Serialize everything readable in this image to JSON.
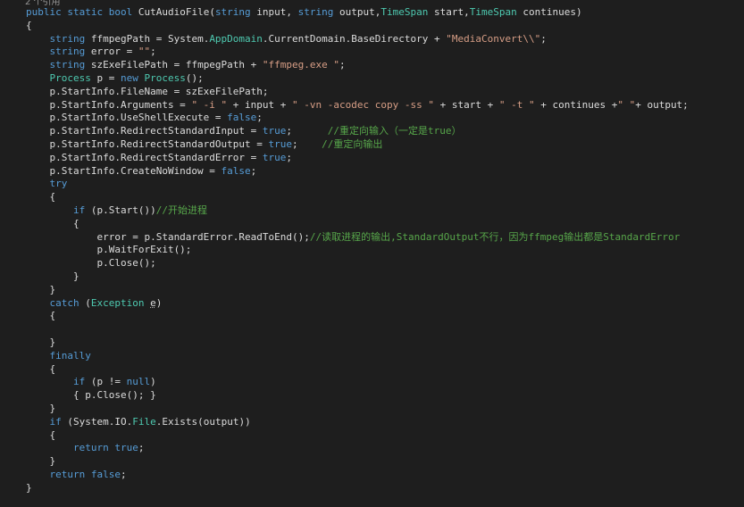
{
  "codelens": "2 个引用",
  "colors": {
    "background": "#1e1e1e",
    "plain": "#dcdcdc",
    "keyword": "#569cd6",
    "type": "#4ec9b0",
    "string": "#d69d85",
    "comment": "#57a64a"
  },
  "code_lines": [
    [
      [
        "kw",
        "public static bool "
      ],
      [
        "pl",
        "CutAudioFile("
      ],
      [
        "kw",
        "string "
      ],
      [
        "pl",
        "input, "
      ],
      [
        "kw",
        "string "
      ],
      [
        "pl",
        "output,"
      ],
      [
        "ty",
        "TimeSpan "
      ],
      [
        "pl",
        "start,"
      ],
      [
        "ty",
        "TimeSpan "
      ],
      [
        "pl",
        "continues)"
      ]
    ],
    [
      [
        "pl",
        "{"
      ]
    ],
    [
      [
        "pl",
        "    "
      ],
      [
        "kw",
        "string "
      ],
      [
        "pl",
        "ffmpegPath = System."
      ],
      [
        "ty",
        "AppDomain"
      ],
      [
        "pl",
        ".CurrentDomain.BaseDirectory + "
      ],
      [
        "st",
        "\"MediaConvert\\\\\""
      ],
      [
        "pl",
        ";"
      ]
    ],
    [
      [
        "pl",
        "    "
      ],
      [
        "kw",
        "string "
      ],
      [
        "pl",
        "error = "
      ],
      [
        "st",
        "\"\""
      ],
      [
        "pl",
        ";"
      ]
    ],
    [
      [
        "pl",
        "    "
      ],
      [
        "kw",
        "string "
      ],
      [
        "pl",
        "szExeFilePath = ffmpegPath + "
      ],
      [
        "st",
        "\"ffmpeg.exe \""
      ],
      [
        "pl",
        ";"
      ]
    ],
    [
      [
        "pl",
        "    "
      ],
      [
        "ty",
        "Process "
      ],
      [
        "pl",
        "p = "
      ],
      [
        "kw",
        "new "
      ],
      [
        "ty",
        "Process"
      ],
      [
        "pl",
        "();"
      ]
    ],
    [
      [
        "pl",
        "    p.StartInfo.FileName = szExeFilePath;"
      ]
    ],
    [
      [
        "pl",
        "    p.StartInfo.Arguments = "
      ],
      [
        "st",
        "\" -i \""
      ],
      [
        "pl",
        " + input + "
      ],
      [
        "st",
        "\" -vn -acodec copy -ss \""
      ],
      [
        "pl",
        " + start + "
      ],
      [
        "st",
        "\" -t \""
      ],
      [
        "pl",
        " + continues +"
      ],
      [
        "st",
        "\" \""
      ],
      [
        "pl",
        "+ output;"
      ]
    ],
    [
      [
        "pl",
        "    p.StartInfo.UseShellExecute = "
      ],
      [
        "kw",
        "false"
      ],
      [
        "pl",
        ";"
      ]
    ],
    [
      [
        "pl",
        "    p.StartInfo.RedirectStandardInput = "
      ],
      [
        "kw",
        "true"
      ],
      [
        "pl",
        ";      "
      ],
      [
        "cm",
        "//重定向输入（一定是true）"
      ]
    ],
    [
      [
        "pl",
        "    p.StartInfo.RedirectStandardOutput = "
      ],
      [
        "kw",
        "true"
      ],
      [
        "pl",
        ";    "
      ],
      [
        "cm",
        "//重定向输出"
      ]
    ],
    [
      [
        "pl",
        "    p.StartInfo.RedirectStandardError = "
      ],
      [
        "kw",
        "true"
      ],
      [
        "pl",
        ";"
      ]
    ],
    [
      [
        "pl",
        "    p.StartInfo.CreateNoWindow = "
      ],
      [
        "kw",
        "false"
      ],
      [
        "pl",
        ";"
      ]
    ],
    [
      [
        "pl",
        "    "
      ],
      [
        "kw",
        "try"
      ]
    ],
    [
      [
        "pl",
        "    {"
      ]
    ],
    [
      [
        "pl",
        "        "
      ],
      [
        "kw",
        "if "
      ],
      [
        "pl",
        "(p.Start())"
      ],
      [
        "cm",
        "//开始进程"
      ]
    ],
    [
      [
        "pl",
        "        {"
      ]
    ],
    [
      [
        "pl",
        "            error = p.StandardError.ReadToEnd();"
      ],
      [
        "cm",
        "//读取进程的输出,StandardOutput不行，因为ffmpeg输出都是StandardError"
      ]
    ],
    [
      [
        "pl",
        "            p.WaitForExit();"
      ]
    ],
    [
      [
        "pl",
        "            p.Close();"
      ]
    ],
    [
      [
        "pl",
        "        }"
      ]
    ],
    [
      [
        "pl",
        "    }"
      ]
    ],
    [
      [
        "pl",
        "    "
      ],
      [
        "kw",
        "catch "
      ],
      [
        "pl",
        "("
      ],
      [
        "ty",
        "Exception "
      ],
      [
        "sq",
        "e"
      ],
      [
        "pl",
        ")"
      ]
    ],
    [
      [
        "pl",
        "    {"
      ]
    ],
    [
      [
        "pl",
        ""
      ]
    ],
    [
      [
        "pl",
        "    }"
      ]
    ],
    [
      [
        "pl",
        "    "
      ],
      [
        "kw",
        "finally"
      ]
    ],
    [
      [
        "pl",
        "    {"
      ]
    ],
    [
      [
        "pl",
        "        "
      ],
      [
        "kw",
        "if "
      ],
      [
        "pl",
        "(p != "
      ],
      [
        "kw",
        "null"
      ],
      [
        "pl",
        ")"
      ]
    ],
    [
      [
        "pl",
        "        { p.Close(); }"
      ]
    ],
    [
      [
        "pl",
        "    }"
      ]
    ],
    [
      [
        "pl",
        "    "
      ],
      [
        "kw",
        "if "
      ],
      [
        "pl",
        "(System.IO."
      ],
      [
        "ty",
        "File"
      ],
      [
        "pl",
        ".Exists(output))"
      ]
    ],
    [
      [
        "pl",
        "    {"
      ]
    ],
    [
      [
        "pl",
        "        "
      ],
      [
        "kw",
        "return true"
      ],
      [
        "pl",
        ";"
      ]
    ],
    [
      [
        "pl",
        "    }"
      ]
    ],
    [
      [
        "pl",
        "    "
      ],
      [
        "kw",
        "return false"
      ],
      [
        "pl",
        ";"
      ]
    ],
    [
      [
        "pl",
        "}"
      ]
    ]
  ]
}
